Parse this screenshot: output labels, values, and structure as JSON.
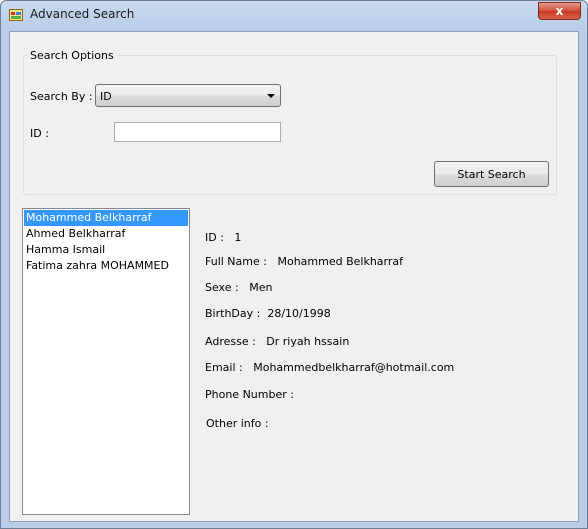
{
  "window": {
    "title": "Advanced Search",
    "close_glyph": "x"
  },
  "search_options": {
    "group_title": "Search Options",
    "search_by_label": "Search By :",
    "search_by_value": "ID",
    "id_label": "ID :",
    "id_value": "",
    "start_button": "Start Search"
  },
  "results": {
    "items": [
      "Mohammed Belkharraf",
      "Ahmed Belkharraf",
      "Hamma Ismail",
      "Fatima zahra MOHAMMED"
    ],
    "selected_index": 0
  },
  "details": {
    "id_label": "ID :",
    "id_value": "1",
    "fullname_label": "Full Name :",
    "fullname_value": "Mohammed Belkharraf",
    "sexe_label": "Sexe :",
    "sexe_value": "Men",
    "birthday_label": "BirthDay :",
    "birthday_value": "28/10/1998",
    "adresse_label": "Adresse :",
    "adresse_value": "Dr riyah hssain",
    "email_label": "Email :",
    "email_value": "Mohammedbelkharraf@hotmail.com",
    "phone_label": "Phone Number :",
    "phone_value": "",
    "other_label": "Other info :",
    "other_value": ""
  },
  "icons": {
    "app": "window-icon",
    "close": "close-icon",
    "dropdown": "chevron-down-icon"
  },
  "colors": {
    "selection": "#3399ff",
    "close_button": "#c2391f"
  }
}
